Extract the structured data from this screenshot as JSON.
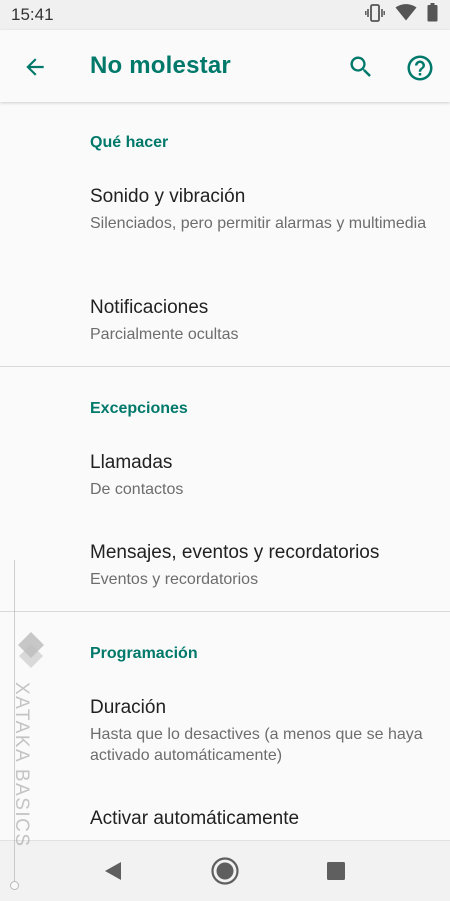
{
  "status_bar": {
    "time": "15:41",
    "icons": [
      "vibrate-icon",
      "wifi-icon",
      "battery-icon"
    ]
  },
  "app_bar": {
    "title": "No molestar",
    "back_icon": "arrow-back-icon",
    "search_icon": "search-icon",
    "help_icon": "help-icon"
  },
  "sections": [
    {
      "header": "Qué hacer",
      "items": [
        {
          "title": "Sonido y vibración",
          "summary": "Silenciados, pero permitir alarmas y multimedia"
        },
        {
          "title": "Notificaciones",
          "summary": "Parcialmente ocultas"
        }
      ]
    },
    {
      "header": "Excepciones",
      "items": [
        {
          "title": "Llamadas",
          "summary": "De contactos"
        },
        {
          "title": "Mensajes, eventos y recordatorios",
          "summary": "Eventos y recordatorios"
        }
      ]
    },
    {
      "header": "Programación",
      "items": [
        {
          "title": "Duración",
          "summary": "Hasta que lo desactives (a menos que se haya activado automáticamente)"
        },
        {
          "title": "Activar automáticamente",
          "summary": ""
        }
      ]
    }
  ],
  "watermark": {
    "text": "XATAKA BASICS"
  },
  "nav_bar": {
    "back": "nav-back-icon",
    "home": "nav-home-icon",
    "recents": "nav-recents-icon"
  },
  "colors": {
    "accent": "#00796b",
    "background": "#fafafa",
    "summary_text": "#6d6d6d"
  }
}
